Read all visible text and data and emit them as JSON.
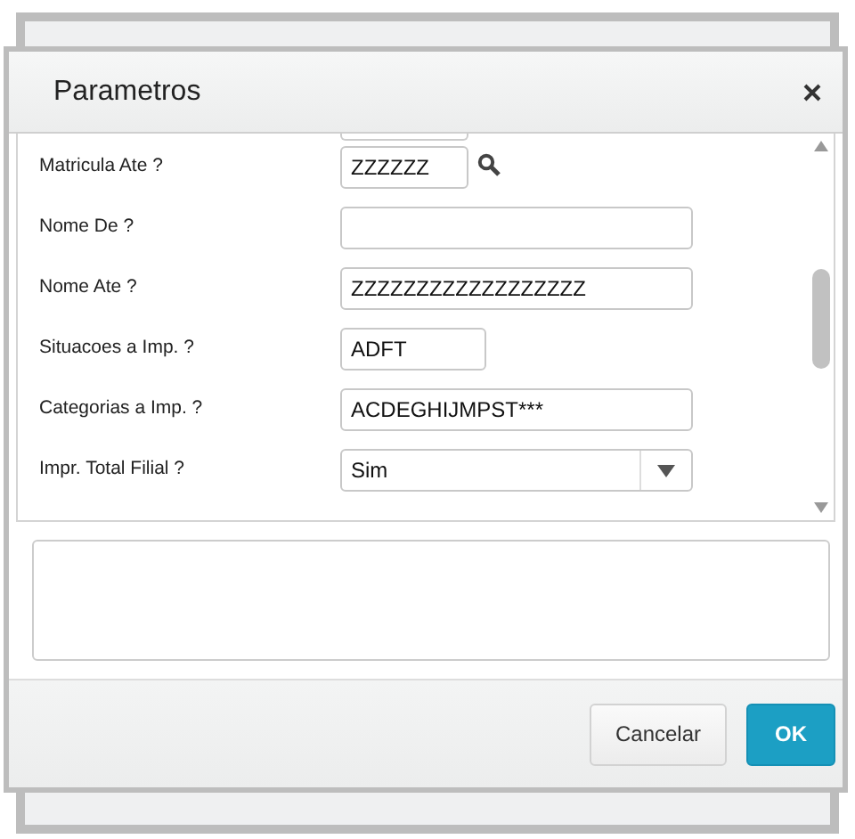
{
  "dialog": {
    "title": "Parametros"
  },
  "fields": [
    {
      "kind": "lookup",
      "label": "Matricula Ate ?",
      "value": "ZZZZZZ"
    },
    {
      "kind": "text",
      "label": "Nome De ?"
    },
    {
      "kind": "text",
      "label": "Nome Ate ?",
      "value": "ZZZZZZZZZZZZZZZZZZ"
    },
    {
      "kind": "text",
      "label": "Situacoes a Imp. ?",
      "value": "ADFT"
    },
    {
      "kind": "text",
      "label": "Categorias a Imp. ?",
      "value": "ACDEGHIJMPST***"
    },
    {
      "kind": "select",
      "label": "Impr. Total Filial ?",
      "value": "Sim"
    }
  ],
  "buttons": [
    {
      "label": "Cancelar",
      "kind": "secondary"
    },
    {
      "label": "OK",
      "kind": "primary"
    }
  ]
}
